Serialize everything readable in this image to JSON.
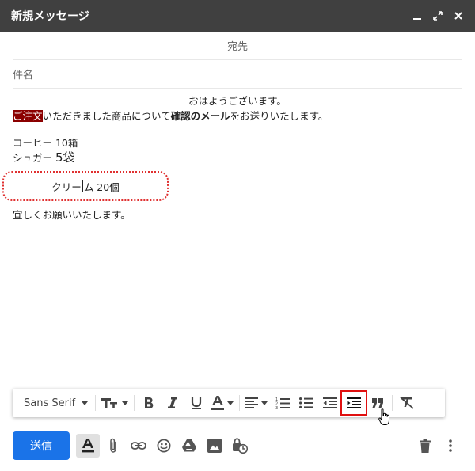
{
  "window": {
    "title": "新規メッセージ"
  },
  "to": {
    "placeholder": "宛先"
  },
  "subject": {
    "placeholder": "件名"
  },
  "body": {
    "greeting": "おはようございます。",
    "line2_highlight": "ご注文",
    "line2_part1": "いただきました商品について",
    "line2_bold": "確認のメール",
    "line2_part2": "をお送りいたします。",
    "item1": "コーヒー 10箱",
    "item2_prefix": "シュガー ",
    "item2_big": "5袋",
    "item3_a": "クリー",
    "item3_b": "ム 20個",
    "closing": "宜しくお願いいたします。"
  },
  "toolbar": {
    "font_label": "Sans Serif"
  },
  "footer": {
    "send_label": "送信"
  },
  "colors": {
    "titlebar": "#404040",
    "send": "#1a73e8",
    "highlight": "#8b0000",
    "active_outline": "#e01010"
  }
}
